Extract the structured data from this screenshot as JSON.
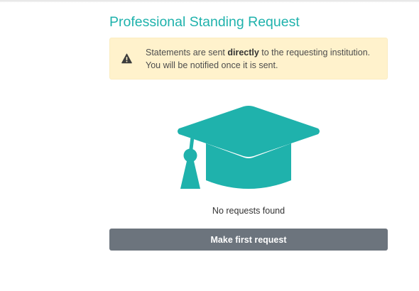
{
  "page": {
    "title": "Professional Standing Request"
  },
  "notice": {
    "text_before": "Statements are sent ",
    "text_bold": "directly",
    "text_after": " to the requesting institution. You will be notified once it is sent.",
    "icon": "warning-icon",
    "background_color": "#fff2cc"
  },
  "empty_state": {
    "icon": "graduation-cap-icon",
    "icon_color": "#1fb2ac",
    "message": "No requests found"
  },
  "actions": {
    "primary_label": "Make first request",
    "primary_color": "#6c747d"
  },
  "colors": {
    "accent": "#1fb2ac"
  }
}
